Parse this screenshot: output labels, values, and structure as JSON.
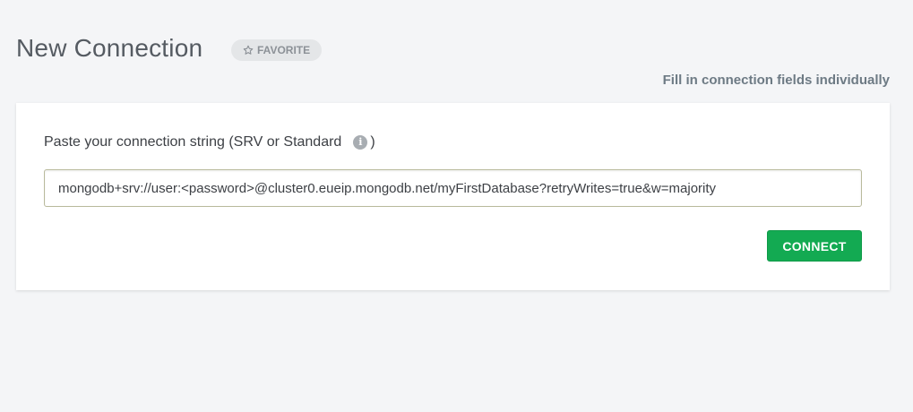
{
  "header": {
    "title": "New Connection",
    "favorite_label": "FAVORITE",
    "favorite_icon": "star-outline-icon"
  },
  "fill_individually_link": "Fill in connection fields individually",
  "connection_card": {
    "label": "Paste your connection string (SRV or Standard",
    "label_suffix": ")",
    "info_icon": "info-icon",
    "connection_string_value": "mongodb+srv://user:<password>@cluster0.eueip.mongodb.net/myFirstDatabase?retryWrites=true&w=majority",
    "connect_label": "CONNECT"
  },
  "colors": {
    "background": "#f4f5f7",
    "connect_button": "#13aa52",
    "title_text": "#555b62"
  }
}
